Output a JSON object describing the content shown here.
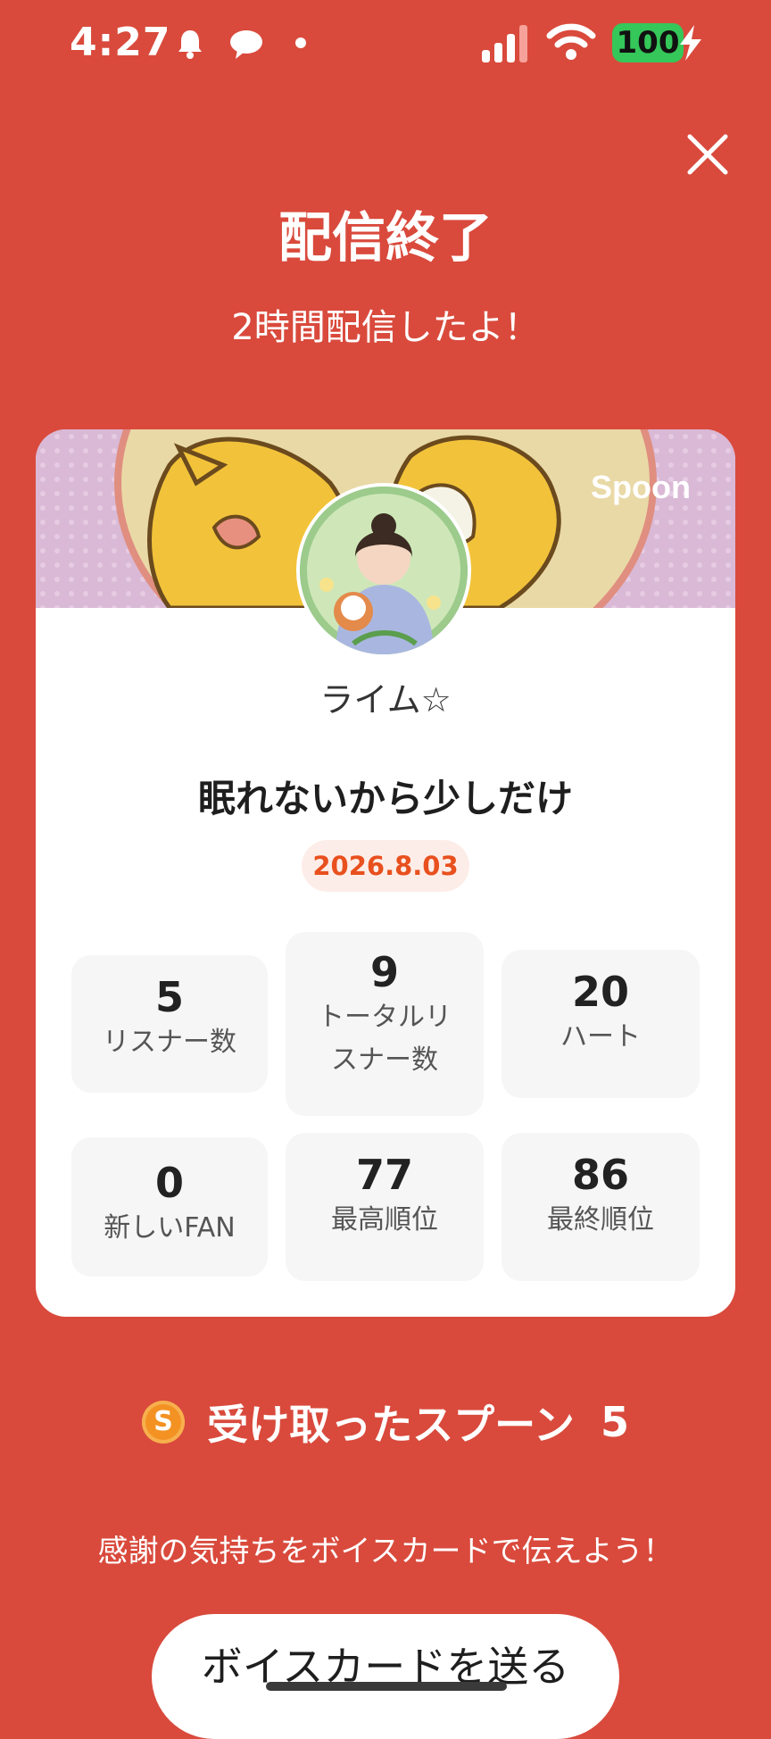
{
  "status_bar": {
    "time": "4:27",
    "battery": "100",
    "icons": [
      "bell-icon",
      "chat-bubble-icon",
      "dot-icon",
      "signal-icon",
      "wifi-icon",
      "charging-bolt-icon"
    ]
  },
  "header": {
    "title": "配信終了",
    "subtitle": "2時間配信したよ！",
    "close_icon": "close-icon"
  },
  "card": {
    "brand": "Spoon",
    "username": "ライム☆",
    "stream_title": "眠れないから少しだけ",
    "date": "2026.8.03",
    "stats": [
      {
        "value": "5",
        "label": "リスナー数"
      },
      {
        "value": "9",
        "label": "トータルリ\nスナー数"
      },
      {
        "value": "20",
        "label": "ハート"
      },
      {
        "value": "0",
        "label": "新しいFAN"
      },
      {
        "value": "77",
        "label": "最高順位"
      },
      {
        "value": "86",
        "label": "最終順位"
      }
    ]
  },
  "spoons": {
    "coin_letter": "S",
    "label": "受け取ったスプーン",
    "count": "5"
  },
  "thanks_text": "感謝の気持ちをボイスカードで伝えよう！",
  "voice_card_button": "ボイスカードを送る",
  "colors": {
    "background": "#D94A3C",
    "date_text": "#E8501E",
    "coin": "#F39223",
    "battery": "#35C759"
  }
}
